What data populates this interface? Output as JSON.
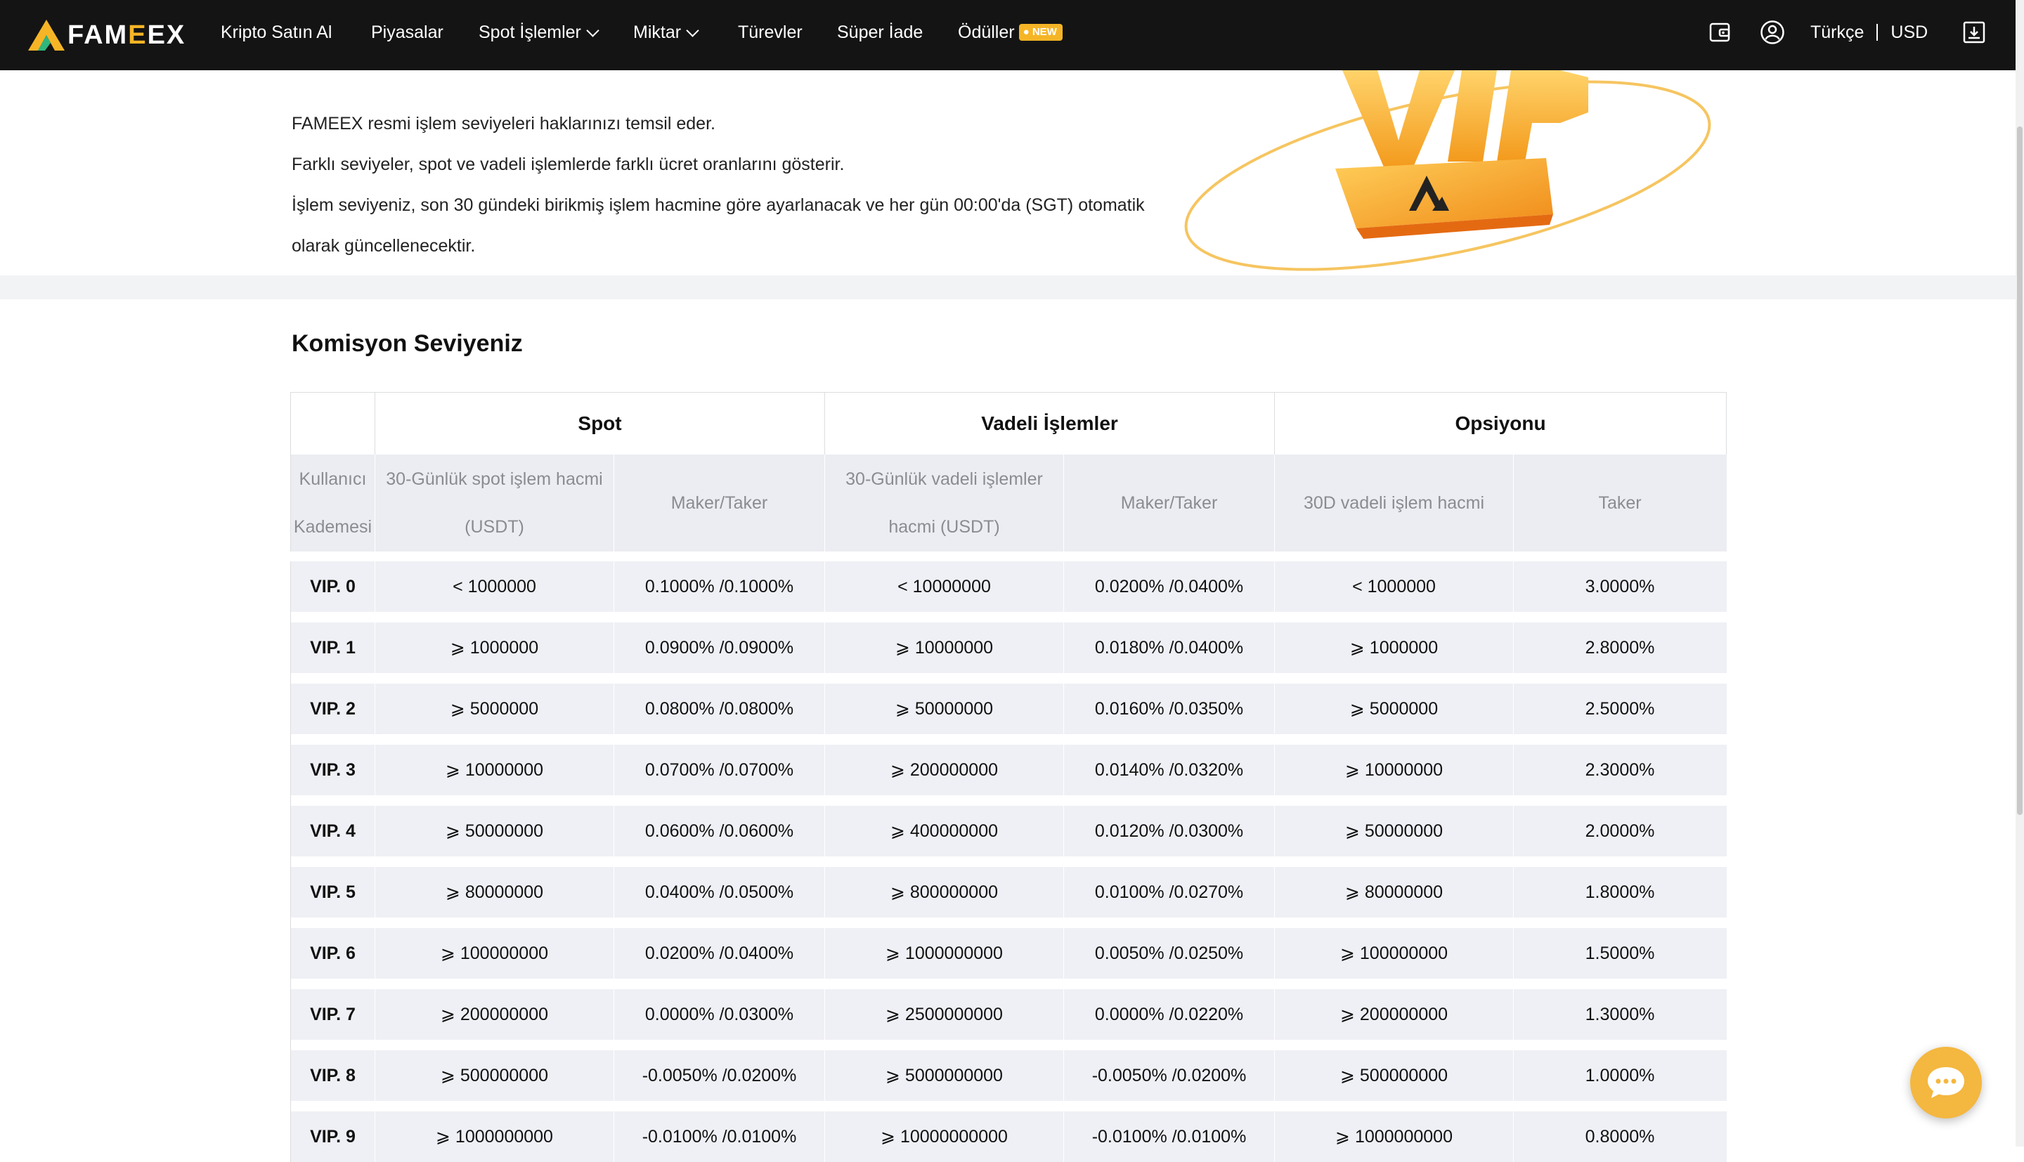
{
  "navbar": {
    "logo_prefix": "FAM",
    "logo_highlight": "E",
    "logo_suffix": "EX",
    "items": [
      {
        "label": "Kripto Satın Al"
      },
      {
        "label": "Piyasalar"
      },
      {
        "label": "Spot İşlemler"
      },
      {
        "label": "Miktar"
      },
      {
        "label": "Türevler"
      },
      {
        "label": "Süper İade"
      },
      {
        "label": "Ödüller"
      }
    ],
    "badge": "NEW",
    "language": "Türkçe",
    "currency": "USD",
    "icons": [
      "wallet-icon",
      "user-icon",
      "download-icon"
    ]
  },
  "intro": {
    "lines": [
      "FAMEEX resmi işlem seviyeleri haklarınızı temsil eder.",
      "Farklı seviyeler, spot ve vadeli işlemlerde farklı ücret oranlarını gösterir.",
      "İşlem seviyeniz, son 30 gündeki birikmiş işlem hacmine göre ayarlanacak ve her gün 00:00'da (SGT) otomatik",
      "olarak güncellenecektir."
    ]
  },
  "section": {
    "title": "Komisyon Seviyeniz"
  },
  "table": {
    "groups": [
      "Spot",
      "Vadeli İşlemler",
      "Opsiyonu"
    ],
    "subheaders": {
      "tier_line1": "Kullanıcı",
      "tier_line2": "Kademesi",
      "spot_volume_line1": "30-Günlük spot işlem hacmi",
      "spot_volume_line2": "(USDT)",
      "spot_fee": "Maker/Taker",
      "futures_volume_line1": "30-Günlük vadeli işlemler",
      "futures_volume_line2": "hacmi (USDT)",
      "futures_fee": "Maker/Taker",
      "options_volume": "30D vadeli işlem hacmi",
      "options_fee": "Taker"
    },
    "rows": [
      [
        "VIP. 0",
        "< 1000000",
        "0.1000% /0.1000%",
        "< 10000000",
        "0.0200% /0.0400%",
        "< 1000000",
        "3.0000%"
      ],
      [
        "VIP. 1",
        "⩾ 1000000",
        "0.0900% /0.0900%",
        "⩾ 10000000",
        "0.0180% /0.0400%",
        "⩾ 1000000",
        "2.8000%"
      ],
      [
        "VIP. 2",
        "⩾ 5000000",
        "0.0800% /0.0800%",
        "⩾ 50000000",
        "0.0160% /0.0350%",
        "⩾ 5000000",
        "2.5000%"
      ],
      [
        "VIP. 3",
        "⩾ 10000000",
        "0.0700% /0.0700%",
        "⩾ 200000000",
        "0.0140% /0.0320%",
        "⩾ 10000000",
        "2.3000%"
      ],
      [
        "VIP. 4",
        "⩾ 50000000",
        "0.0600% /0.0600%",
        "⩾ 400000000",
        "0.0120% /0.0300%",
        "⩾ 50000000",
        "2.0000%"
      ],
      [
        "VIP. 5",
        "⩾ 80000000",
        "0.0400% /0.0500%",
        "⩾ 800000000",
        "0.0100% /0.0270%",
        "⩾ 80000000",
        "1.8000%"
      ],
      [
        "VIP. 6",
        "⩾ 100000000",
        "0.0200% /0.0400%",
        "⩾ 1000000000",
        "0.0050% /0.0250%",
        "⩾ 100000000",
        "1.5000%"
      ],
      [
        "VIP. 7",
        "⩾ 200000000",
        "0.0000% /0.0300%",
        "⩾ 2500000000",
        "0.0000% /0.0220%",
        "⩾ 200000000",
        "1.3000%"
      ],
      [
        "VIP. 8",
        "⩾ 500000000",
        "-0.0050% /0.0200%",
        "⩾ 5000000000",
        "-0.0050% /0.0200%",
        "⩾ 500000000",
        "1.0000%"
      ],
      [
        "VIP. 9",
        "⩾ 1000000000",
        "-0.0100% /0.0100%",
        "⩾ 10000000000",
        "-0.0100% /0.0100%",
        "⩾ 1000000000",
        "0.8000%"
      ]
    ]
  },
  "colors": {
    "navbar_bg": "#141414",
    "brand_gold": "#f6b526",
    "table_row_bg": "#eff0f5",
    "header_bg": "#ecedf2"
  }
}
